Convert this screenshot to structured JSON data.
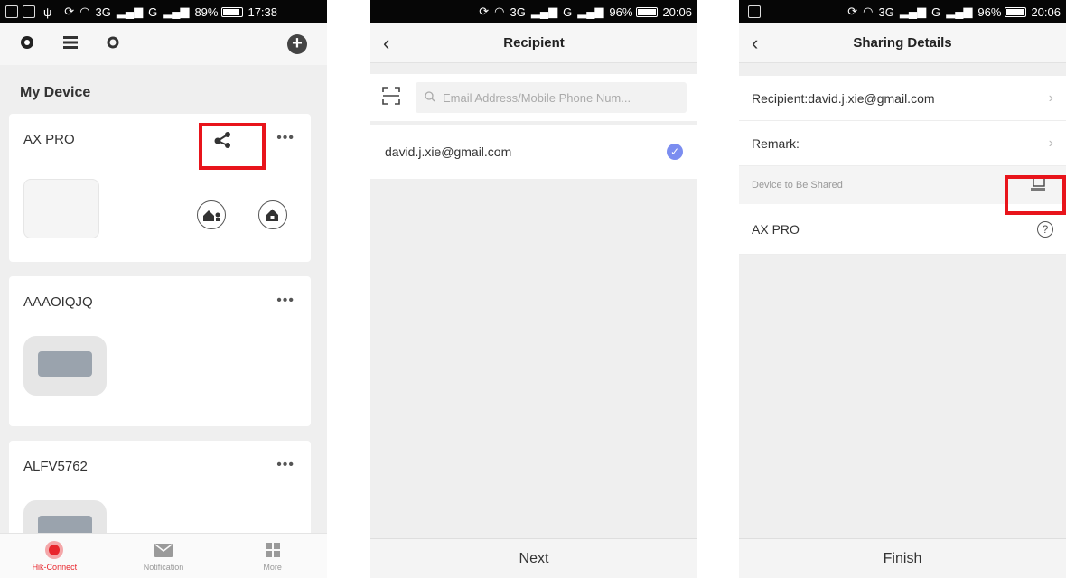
{
  "screens": {
    "device_list": {
      "status": {
        "battery": "89%",
        "time": "17:38",
        "network": "3G",
        "network2": "G"
      },
      "section_title": "My Device",
      "devices": [
        {
          "name": "AX PRO",
          "more": "•••"
        },
        {
          "name": "AAAOIQJQ",
          "more": "•••"
        },
        {
          "name": "ALFV5762",
          "more": "•••"
        }
      ],
      "tabs": [
        {
          "label": "Hik-Connect",
          "icon": "hik-connect-icon"
        },
        {
          "label": "Notification",
          "icon": "envelope-icon"
        },
        {
          "label": "More",
          "icon": "grid-icon"
        }
      ]
    },
    "recipient": {
      "status": {
        "battery": "96%",
        "time": "20:06",
        "network": "3G",
        "network2": "G"
      },
      "title": "Recipient",
      "search_placeholder": "Email Address/Mobile Phone Num...",
      "result": "david.j.xie@gmail.com",
      "next_label": "Next"
    },
    "sharing_details": {
      "status": {
        "battery": "96%",
        "time": "20:06",
        "network": "3G",
        "network2": "G"
      },
      "title": "Sharing Details",
      "recipient_row": "Recipient:david.j.xie@gmail.com",
      "remark_row": "Remark:",
      "device_section": "Device to Be Shared",
      "device_name": "AX PRO",
      "finish_label": "Finish"
    }
  },
  "colors": {
    "accent_red": "#e8141b",
    "check_blue": "#7b8df0",
    "statusbar": "#060606"
  }
}
